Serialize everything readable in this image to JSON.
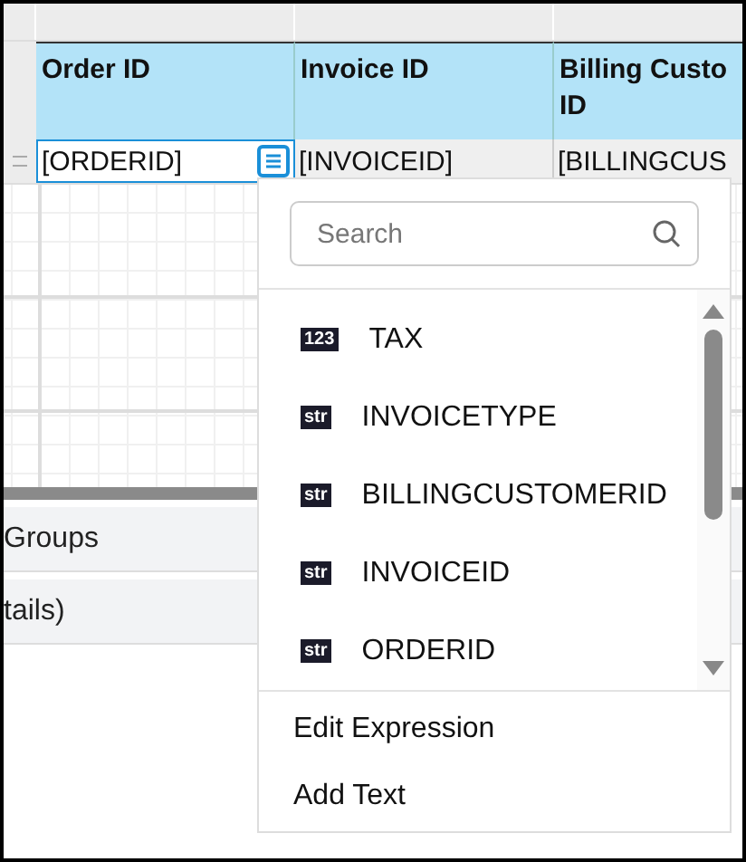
{
  "table": {
    "columns": [
      {
        "label": "Order ID"
      },
      {
        "label": "Invoice ID"
      },
      {
        "label": "Billing Custo\nID"
      }
    ],
    "row": [
      {
        "value": "[ORDERID]",
        "selected": true
      },
      {
        "value": "[INVOICEID]",
        "selected": false
      },
      {
        "value": "[BILLINGCUS",
        "selected": false
      }
    ]
  },
  "panels": [
    {
      "label": "Groups"
    },
    {
      "label": "tails)"
    }
  ],
  "field_menu": {
    "search": {
      "placeholder": "Search"
    },
    "items": [
      {
        "type_badge": "123",
        "label": "TAX"
      },
      {
        "type_badge": "str",
        "label": "INVOICETYPE"
      },
      {
        "type_badge": "str",
        "label": "BILLINGCUSTOMERID"
      },
      {
        "type_badge": "str",
        "label": "INVOICEID"
      },
      {
        "type_badge": "str",
        "label": "ORDERID"
      }
    ],
    "actions": [
      {
        "label": "Edit Expression"
      },
      {
        "label": "Add Text"
      }
    ]
  }
}
